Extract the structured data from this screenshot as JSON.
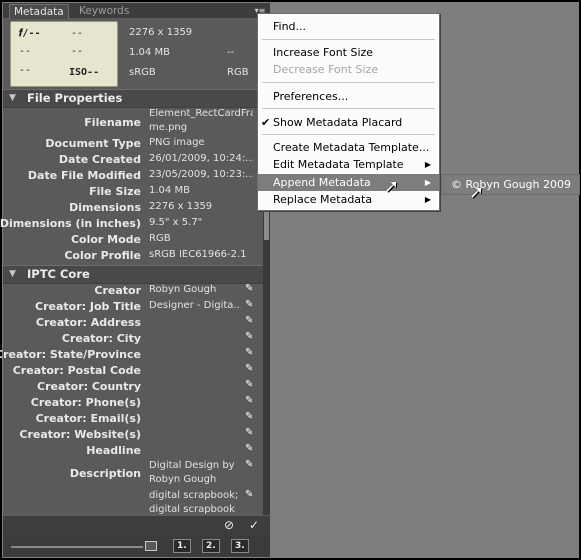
{
  "tabs": [
    "Metadata",
    "Keywords"
  ],
  "placard": {
    "aperture": "𝒇/--",
    "shutter": "--",
    "r2c1": "--",
    "r2c2": "--",
    "r3c1": "--",
    "iso": "ISO--"
  },
  "camera": {
    "dimensions": "2276 x 1359",
    "size": "1.04 MB",
    "size_right": "--",
    "colorspace": "sRGB",
    "mode": "RGB"
  },
  "sections": {
    "file_properties": "File Properties",
    "iptc_core": "IPTC Core"
  },
  "file_properties": [
    {
      "label": "Filename",
      "value": "Element_RectCardFra",
      "value2": "me.png"
    },
    {
      "label": "Document Type",
      "value": "PNG image"
    },
    {
      "label": "Date Created",
      "value": "26/01/2009, 10:24:..."
    },
    {
      "label": "Date File Modified",
      "value": "23/05/2009, 10:23:..."
    },
    {
      "label": "File Size",
      "value": "1.04 MB"
    },
    {
      "label": "Dimensions",
      "value": "2276 x 1359"
    },
    {
      "label": "Dimensions (in inches)",
      "value": "9.5\" x 5.7\""
    },
    {
      "label": "Color Mode",
      "value": "RGB"
    },
    {
      "label": "Color Profile",
      "value": "sRGB IEC61966-2.1"
    }
  ],
  "iptc": [
    {
      "label": "Creator",
      "value": "Robyn Gough"
    },
    {
      "label": "Creator: Job Title",
      "value": "Designer - Digita..."
    },
    {
      "label": "Creator: Address",
      "value": ""
    },
    {
      "label": "Creator: City",
      "value": ""
    },
    {
      "label": "Creator: State/Province",
      "value": ""
    },
    {
      "label": "Creator: Postal Code",
      "value": ""
    },
    {
      "label": "Creator: Country",
      "value": ""
    },
    {
      "label": "Creator: Phone(s)",
      "value": ""
    },
    {
      "label": "Creator: Email(s)",
      "value": ""
    },
    {
      "label": "Creator: Website(s)",
      "value": ""
    },
    {
      "label": "Headline",
      "value": ""
    },
    {
      "label": "Description",
      "value": "Digital Design by",
      "value2": "Robyn Gough"
    },
    {
      "label": "",
      "value": "digital scrapbook;",
      "value2": "digital scrapbook"
    }
  ],
  "footer": {
    "ws1": "1.",
    "ws2": "2.",
    "ws3": "3."
  },
  "menu": {
    "find": "Find...",
    "increase_font": "Increase Font Size",
    "decrease_font": "Decrease Font Size",
    "preferences": "Preferences...",
    "show_placard": "Show Metadata Placard",
    "create_template": "Create Metadata Template...",
    "edit_template": "Edit Metadata Template",
    "append": "Append Metadata",
    "replace": "Replace Metadata"
  },
  "submenu": {
    "item": "© Robyn Gough 2009"
  }
}
